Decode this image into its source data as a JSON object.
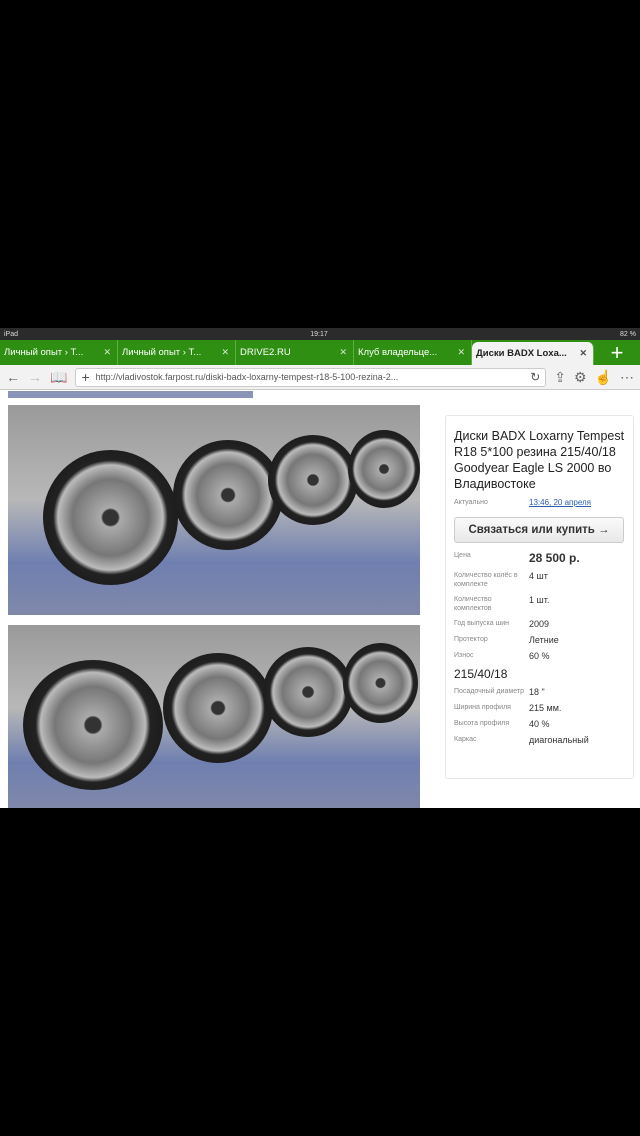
{
  "status": {
    "device": "iPad",
    "time": "19:17",
    "battery": "82 %"
  },
  "tabs": [
    {
      "label": "Личный опыт › Т..."
    },
    {
      "label": "Личный опыт › Т..."
    },
    {
      "label": "DRIVE2.RU"
    },
    {
      "label": "Клуб владельце..."
    },
    {
      "label": "Диски BADX Loxa...",
      "active": true
    }
  ],
  "toolbar": {
    "url": "http://vladivostok.farpost.ru/diski-badx-loxarny-tempest-r18-5-100-rezina-2..."
  },
  "listing": {
    "title": "Диски BADX Loxarny Tempest R18 5*100 резина 215/40/18 Goodyear Eagle LS 2000 во Владивостоке",
    "actual_label": "Актуально",
    "actual_value": "13:46, 20 апреля",
    "buy_label": "Связаться или купить →",
    "price_label": "Цена",
    "price": "28 500 р.",
    "specs": [
      {
        "k": "Количество колёс в комплекте",
        "v": "4 шт"
      },
      {
        "k": "Количество комплектов",
        "v": "1 шт."
      },
      {
        "k": "Год выпуска шин",
        "v": "2009"
      },
      {
        "k": "Протектор",
        "v": "Летние"
      },
      {
        "k": "Износ",
        "v": "60 %"
      }
    ],
    "size_heading": "215/40/18",
    "specs2": [
      {
        "k": "Посадочный диаметр",
        "v": "18 \""
      },
      {
        "k": "Ширина профиля",
        "v": "215 мм."
      },
      {
        "k": "Высота профиля",
        "v": "40 %"
      },
      {
        "k": "Каркас",
        "v": "диагональный"
      }
    ]
  }
}
